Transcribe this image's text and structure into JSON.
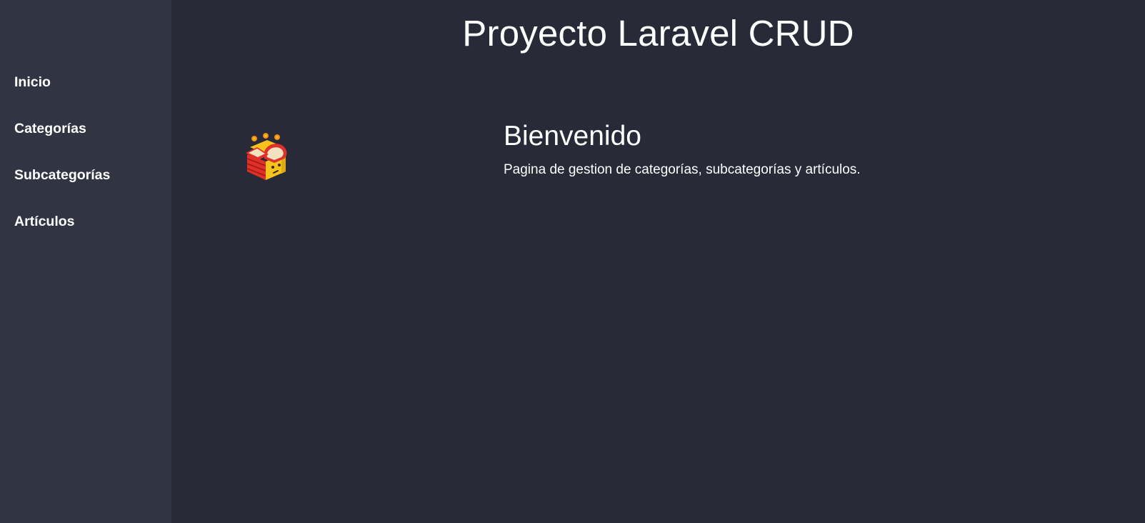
{
  "header": {
    "title": "Proyecto Laravel CRUD"
  },
  "sidebar": {
    "items": [
      {
        "label": "Inicio"
      },
      {
        "label": "Categorías"
      },
      {
        "label": "Subcategorías"
      },
      {
        "label": "Artículos"
      }
    ]
  },
  "main": {
    "welcome_title": "Bienvenido",
    "welcome_text": "Pagina de gestion de categorías, subcategorías y artículos.",
    "logo_icon": "laravel-box-icon"
  },
  "colors": {
    "sidebar_bg": "#313543",
    "main_bg": "#282b37",
    "text": "#ffffff",
    "logo_red": "#e0302a",
    "logo_yellow": "#f6c21c",
    "logo_orange": "#f08a1c"
  }
}
